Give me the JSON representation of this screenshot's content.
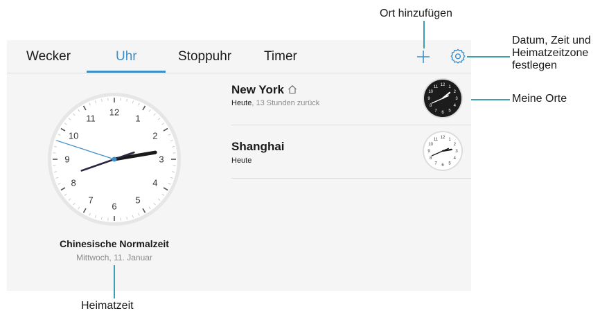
{
  "tabs": [
    {
      "label": "Wecker",
      "active": false
    },
    {
      "label": "Uhr",
      "active": true
    },
    {
      "label": "Stoppuhr",
      "active": false
    },
    {
      "label": "Timer",
      "active": false
    }
  ],
  "actions": {
    "add_icon": "plus-icon",
    "settings_icon": "gear-icon"
  },
  "home_clock": {
    "numbers": [
      "12",
      "1",
      "2",
      "3",
      "4",
      "5",
      "6",
      "7",
      "8",
      "9",
      "10",
      "11"
    ],
    "title": "Chinesische Normalzeit",
    "date": "Mittwoch, 11. Januar",
    "time": {
      "hour": 2,
      "minute": 41,
      "second": 48
    }
  },
  "cities": [
    {
      "name": "New York",
      "home_icon": "home-icon",
      "day": "Heute",
      "offset": ", 13 Stunden zurück",
      "dial": "dark",
      "time": {
        "hour": 13,
        "minute": 41
      }
    },
    {
      "name": "Shanghai",
      "day": "Heute",
      "offset": "",
      "dial": "light",
      "time": {
        "hour": 2,
        "minute": 41
      }
    }
  ],
  "callouts": {
    "add": "Ort hinzufügen",
    "settings_line1": "Datum, Zeit und",
    "settings_line2": "Heimatzeitzone",
    "settings_line3": "festlegen",
    "my_places": "Meine Orte",
    "home_time": "Heimatzeit"
  },
  "colors": {
    "accent": "#3d8fc9",
    "leader": "#3aa0b0",
    "screen_bg": "#f5f5f5"
  }
}
